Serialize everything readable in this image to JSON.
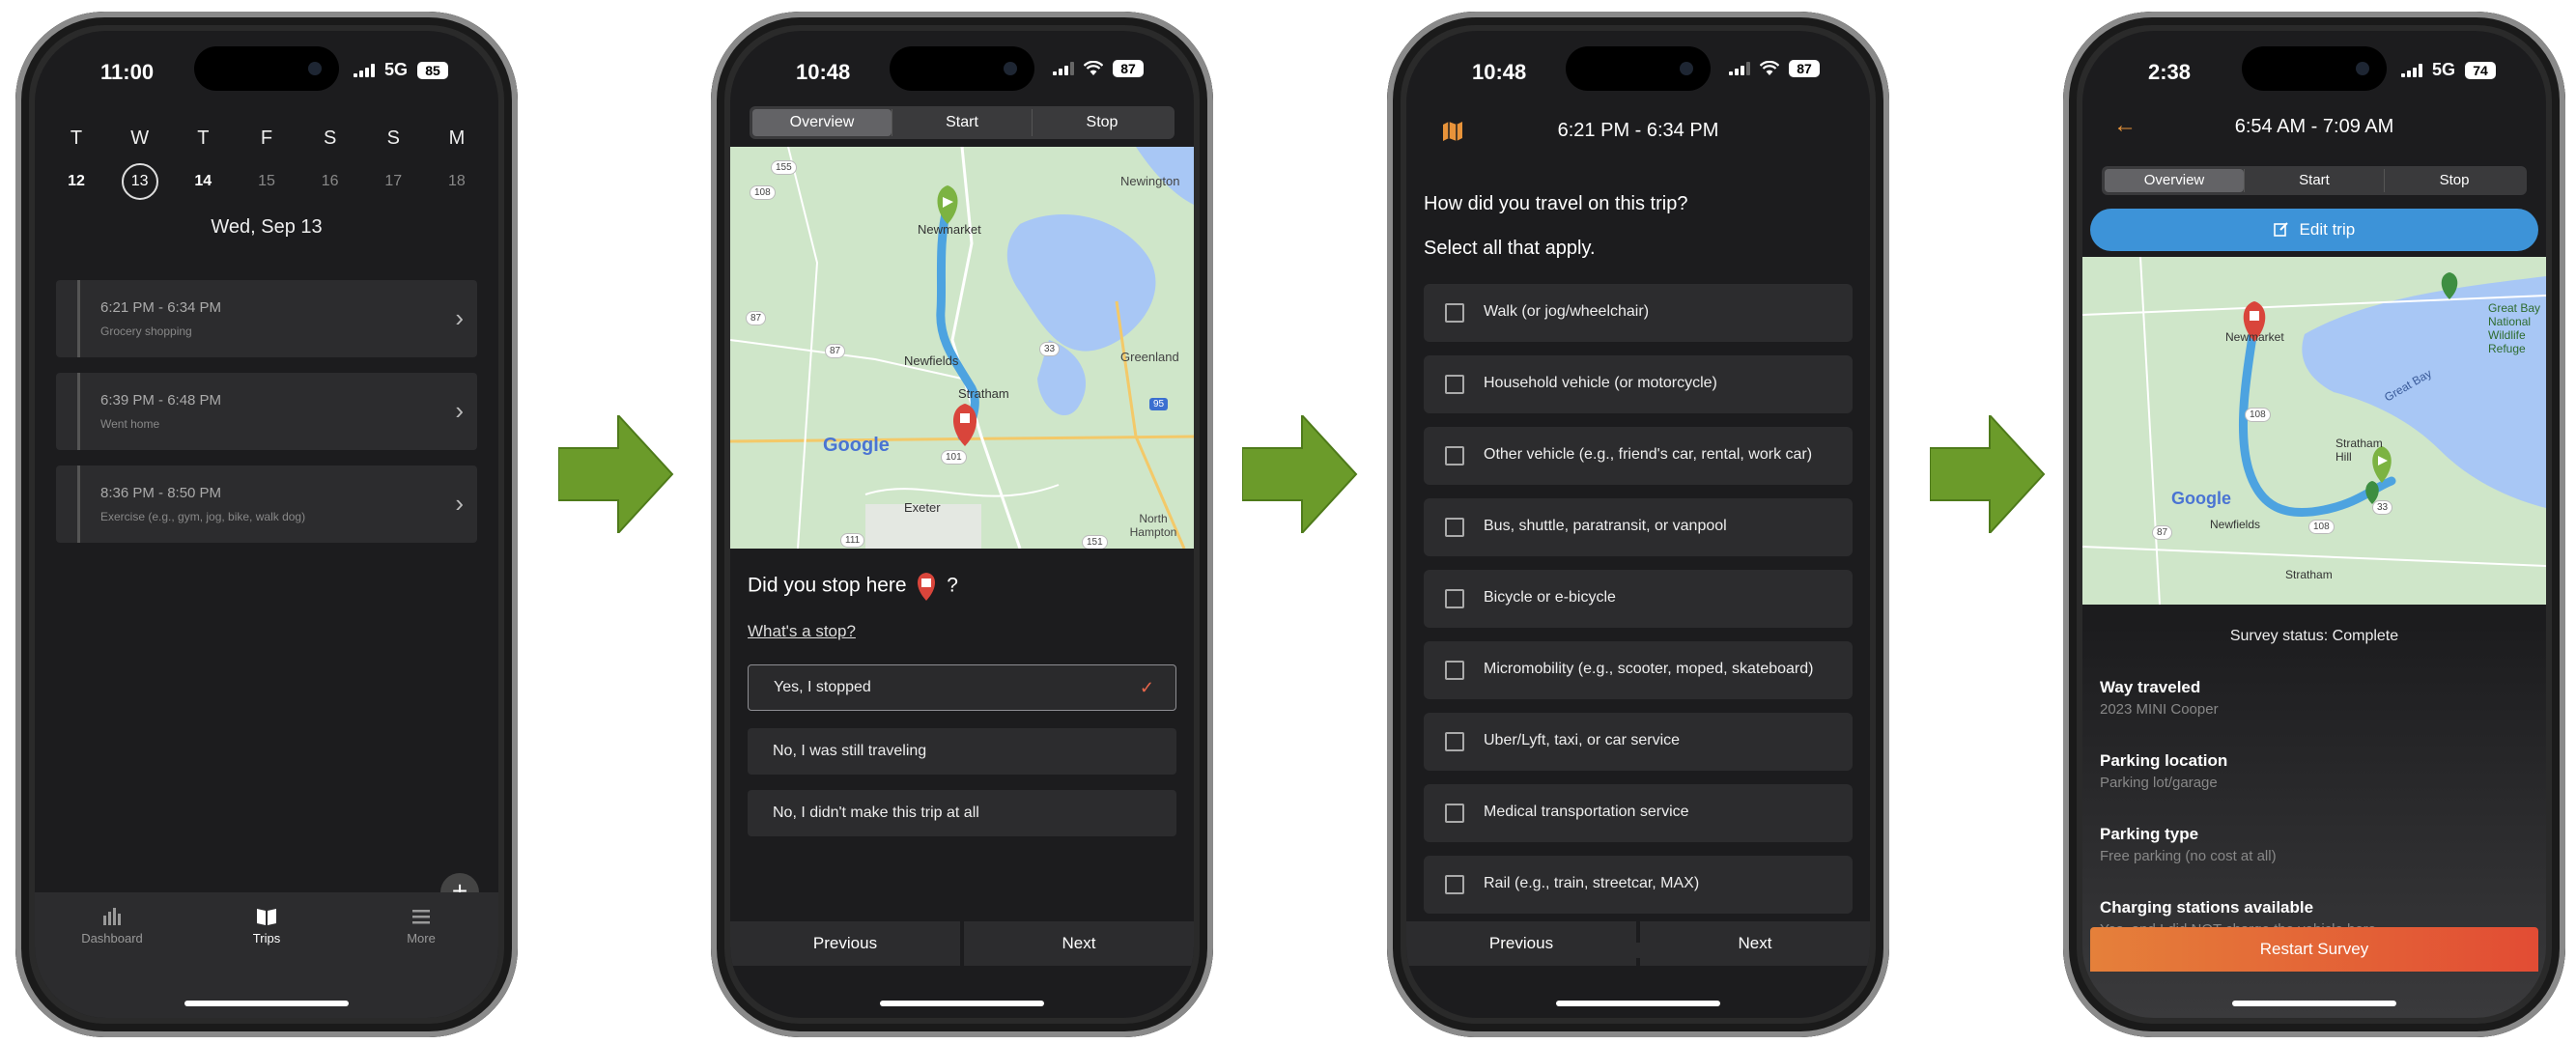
{
  "screen1": {
    "status_time": "11:00",
    "status_network": "5G",
    "status_battery": "85",
    "week": [
      {
        "letter": "T",
        "num": "12"
      },
      {
        "letter": "W",
        "num": "13"
      },
      {
        "letter": "T",
        "num": "14"
      },
      {
        "letter": "F",
        "num": "15"
      },
      {
        "letter": "S",
        "num": "16"
      },
      {
        "letter": "S",
        "num": "17"
      },
      {
        "letter": "M",
        "num": "18"
      }
    ],
    "date_title": "Wed, Sep 13",
    "trips": [
      {
        "time": "6:21 PM - 6:34 PM",
        "purpose": "Grocery shopping"
      },
      {
        "time": "6:39 PM - 6:48 PM",
        "purpose": "Went home"
      },
      {
        "time": "8:36 PM - 8:50 PM",
        "purpose": "Exercise (e.g., gym, jog, bike, walk dog)"
      }
    ],
    "fab_label": "+",
    "tabs": [
      {
        "label": "Dashboard"
      },
      {
        "label": "Trips"
      },
      {
        "label": "More"
      }
    ]
  },
  "screen2": {
    "status_time": "10:48",
    "status_battery": "87",
    "segments": [
      "Overview",
      "Start",
      "Stop"
    ],
    "map_labels": {
      "newington": "Newington",
      "newmarket": "Newmarket",
      "newfields": "Newfields",
      "greenland": "Greenland",
      "stratham": "Stratham",
      "exeter": "Exeter",
      "north_hampton": "North Hampton",
      "google": "Google",
      "r155": "155",
      "r108": "108",
      "r87": "87",
      "r33": "33",
      "r101": "101",
      "r95": "95",
      "r111": "111",
      "r151": "151"
    },
    "question_prefix": "Did you stop here",
    "question_suffix": "?",
    "help_link": "What's a stop?",
    "options": [
      "Yes, I stopped",
      "No, I was still traveling",
      "No, I didn't make this trip at all"
    ],
    "check_mark": "✓",
    "prev_label": "Previous",
    "next_label": "Next"
  },
  "screen3": {
    "status_time": "10:48",
    "status_battery": "87",
    "header_time": "6:21 PM - 6:34 PM",
    "question": "How did you travel on this trip?",
    "instruction": "Select all that apply.",
    "modes": [
      "Walk (or jog/wheelchair)",
      "Household vehicle (or motorcycle)",
      "Other vehicle (e.g., friend's car, rental, work car)",
      "Bus, shuttle, paratransit, or vanpool",
      "Bicycle or e-bicycle",
      "Micromobility (e.g., scooter, moped, skateboard)",
      "Uber/Lyft, taxi, or car service",
      "Medical transportation service",
      "Rail (e.g., train, streetcar, MAX)"
    ],
    "prev_label": "Previous",
    "next_label": "Next"
  },
  "screen4": {
    "status_time": "2:38",
    "status_network": "5G",
    "status_battery": "74",
    "back_icon": "←",
    "header_time": "6:54 AM - 7:09 AM",
    "segments": [
      "Overview",
      "Start",
      "Stop"
    ],
    "edit_label": "Edit trip",
    "map_labels": {
      "newmarket": "Newmarket",
      "newfields": "Newfields",
      "stratham": "Stratham",
      "stratham_hill": "Stratham Hill",
      "great_bay": "Great Bay",
      "refuge": "Great Bay National Wildlife Refuge",
      "google": "Google",
      "r108": "108",
      "r33": "33",
      "r87": "87"
    },
    "survey_status": "Survey status: Complete",
    "fields": [
      {
        "label": "Way traveled",
        "value": "2023 MINI Cooper"
      },
      {
        "label": "Parking location",
        "value": "Parking lot/garage"
      },
      {
        "label": "Parking type",
        "value": "Free parking (no cost at all)"
      },
      {
        "label": "Charging stations available",
        "value": "Yes, and I did NOT charge the vehicle here"
      }
    ],
    "restart_label": "Restart Survey"
  },
  "colors": {
    "arrow": "#6b9b2a",
    "accent_orange": "#e8664b",
    "edit_blue": "#3d93d8",
    "pin_red": "#d9453b",
    "route_blue": "#4da3e0",
    "start_green": "#7cb342"
  }
}
